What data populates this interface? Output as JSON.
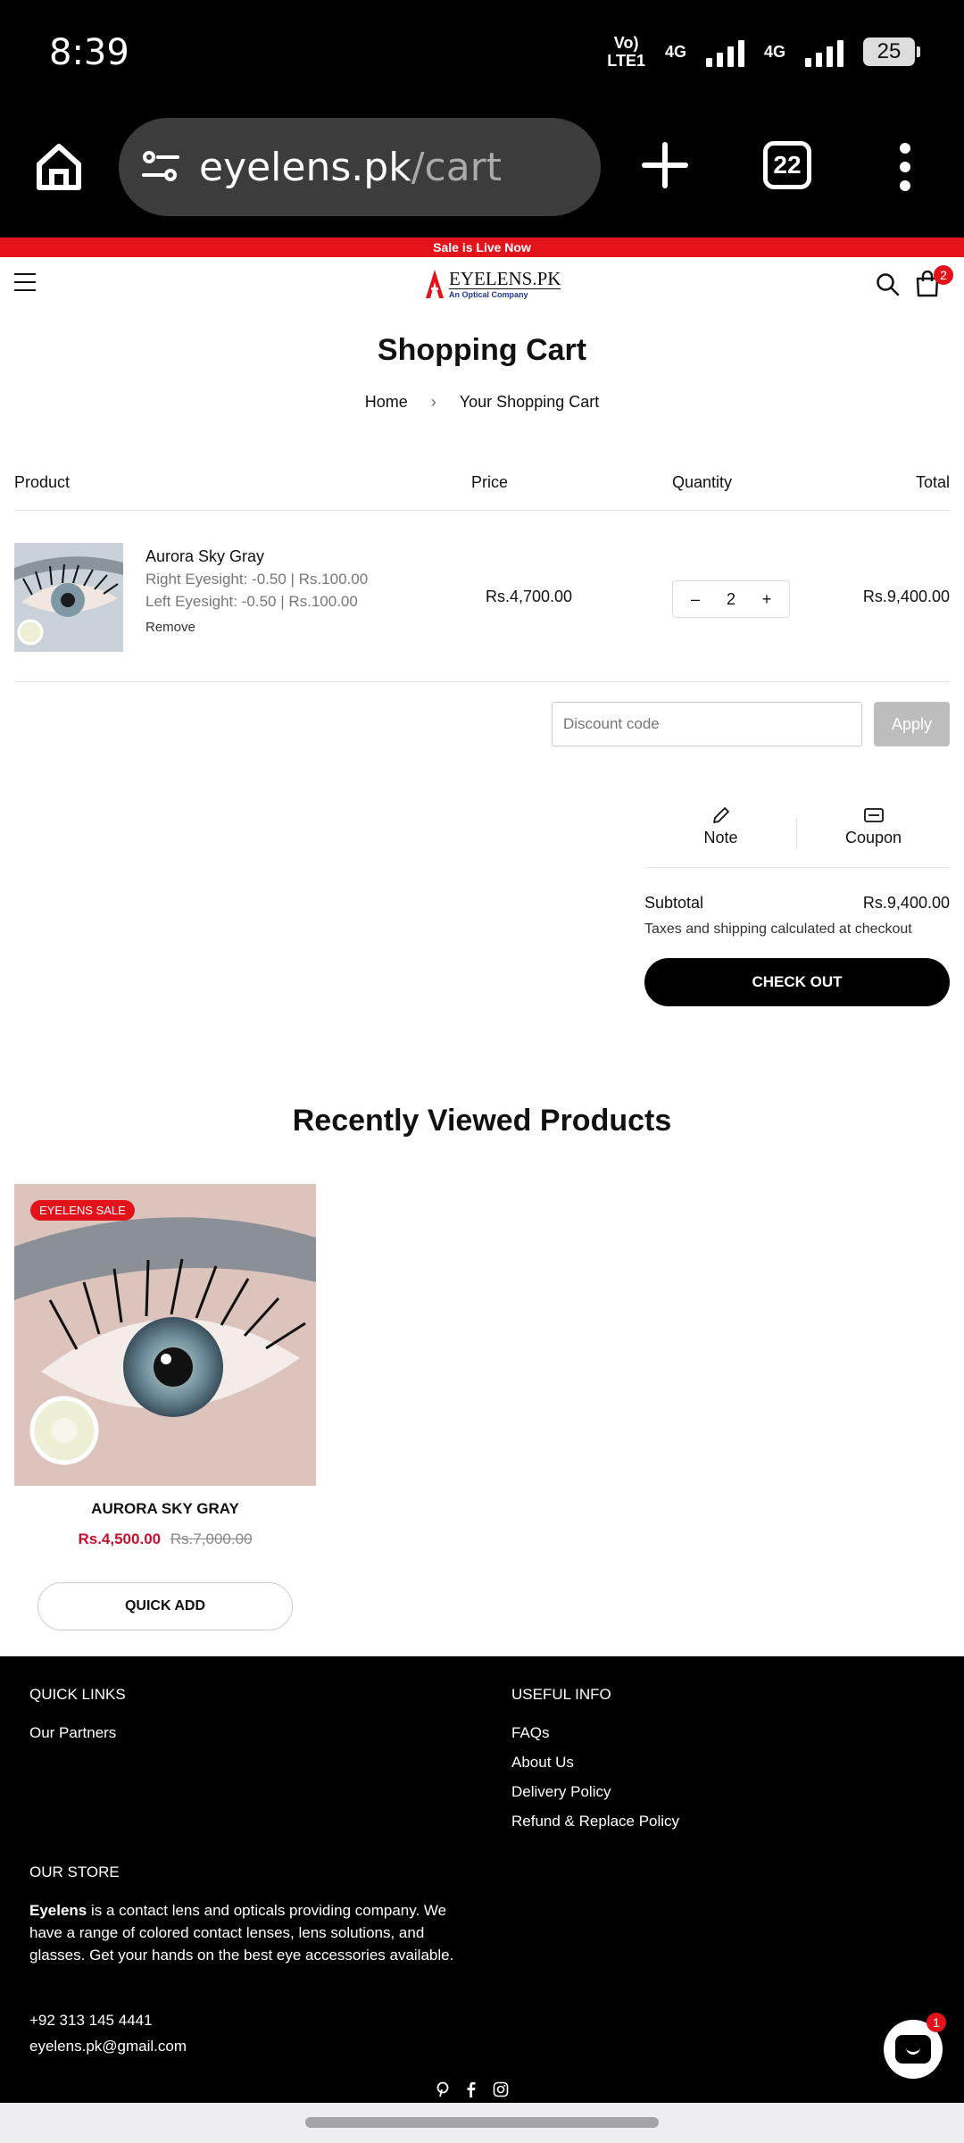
{
  "status_bar": {
    "time": "8:39",
    "volte": "Vo)",
    "lte": "LTE1",
    "net1": "4G",
    "net2": "4G",
    "battery": "25"
  },
  "browser": {
    "url_domain": "eyelens.pk",
    "url_path": "/cart",
    "tab_count": "22"
  },
  "announcement": "Sale is Live Now",
  "header": {
    "logo_name": "EYELENS.PK",
    "logo_sub": "An Optical Company",
    "cart_count": "2"
  },
  "page": {
    "title": "Shopping Cart",
    "breadcrumb": [
      "Home",
      "Your Shopping Cart"
    ]
  },
  "cart": {
    "columns": [
      "Product",
      "Price",
      "Quantity",
      "Total"
    ],
    "items": [
      {
        "name": "Aurora Sky Gray",
        "right_eye": "Right Eyesight: -0.50 | Rs.100.00",
        "left_eye": "Left Eyesight: -0.50 | Rs.100.00",
        "remove_label": "Remove",
        "price": "Rs.4,700.00",
        "quantity": "2",
        "total": "Rs.9,400.00"
      }
    ],
    "discount_placeholder": "Discount code",
    "apply_label": "Apply",
    "note_label": "Note",
    "coupon_label": "Coupon",
    "subtotal_label": "Subtotal",
    "subtotal_value": "Rs.9,400.00",
    "tax_note": "Taxes and shipping calculated at checkout",
    "checkout_label": "CHECK OUT"
  },
  "recently_viewed": {
    "title": "Recently Viewed Products",
    "products": [
      {
        "badge": "EYELENS SALE",
        "name": "AURORA SKY GRAY",
        "sale_price": "Rs.4,500.00",
        "original_price": "Rs.7,000.00",
        "button": "QUICK ADD",
        "image_caption": "Aurora Sky gray"
      }
    ]
  },
  "footer": {
    "quick_links_title": "QUICK LINKS",
    "quick_links": [
      "Our Partners"
    ],
    "useful_info_title": "USEFUL INFO",
    "useful_info": [
      "FAQs",
      "About Us",
      "Delivery Policy",
      "Refund & Replace Policy"
    ],
    "store_title": "OUR STORE",
    "store_brand": "Eyelens",
    "store_text": " is a contact lens and opticals providing company. We have a range of colored contact lenses, lens solutions, and glasses. Get your hands on the best eye accessories available.",
    "phone": "+92 313 145 4441",
    "email": "eyelens.pk@gmail.com",
    "social_icons": [
      "pinterest-icon",
      "facebook-icon",
      "instagram-icon"
    ]
  },
  "chat": {
    "badge": "1"
  },
  "colors": {
    "brand_red": "#e3131b",
    "sale_red": "#c8102e",
    "footer_bg": "#000000"
  }
}
